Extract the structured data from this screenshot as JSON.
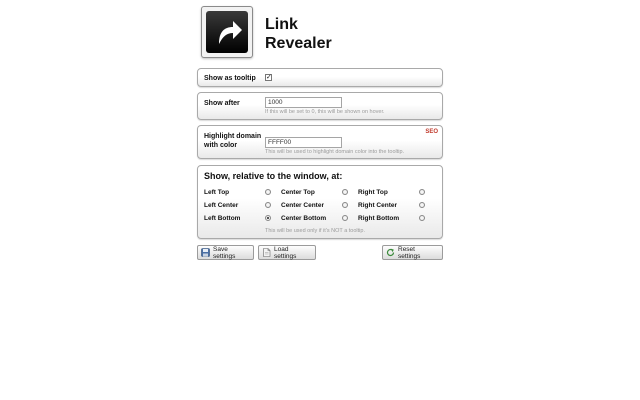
{
  "app": {
    "title_line1": "Link",
    "title_line2": "Revealer",
    "logo_icon": "curved-arrow-icon"
  },
  "tooltip_panel": {
    "label": "Show as tooltip",
    "checked": true,
    "check_glyph": "✓"
  },
  "delay_panel": {
    "label": "Show after",
    "value": "1000",
    "hint": "If this will be set to 0, this will be shown on hover."
  },
  "color_panel": {
    "label_line1": "Highlight domain",
    "label_line2": "with color",
    "value": "FFFF00",
    "hint": "This will be used to highlight domain color into the tooltip.",
    "badge": "SEO",
    "badge_color": "#c0392b"
  },
  "position_panel": {
    "heading": "Show, relative to the window, at:",
    "options": [
      {
        "label": "Left Top",
        "selected": false
      },
      {
        "label": "Center Top",
        "selected": false
      },
      {
        "label": "Right Top",
        "selected": false
      },
      {
        "label": "Left Center",
        "selected": false
      },
      {
        "label": "Center Center",
        "selected": false
      },
      {
        "label": "Right Center",
        "selected": false
      },
      {
        "label": "Left Bottom",
        "selected": true
      },
      {
        "label": "Center Bottom",
        "selected": false
      },
      {
        "label": "Right Bottom",
        "selected": false
      }
    ],
    "hint": "This will be used only if it's NOT a tooltip."
  },
  "buttons": {
    "save": {
      "label": "Save settings",
      "icon": "floppy-disk-icon"
    },
    "load": {
      "label": "Load settings",
      "icon": "document-icon"
    },
    "reset": {
      "label": "Reset settings",
      "icon": "refresh-icon"
    }
  }
}
